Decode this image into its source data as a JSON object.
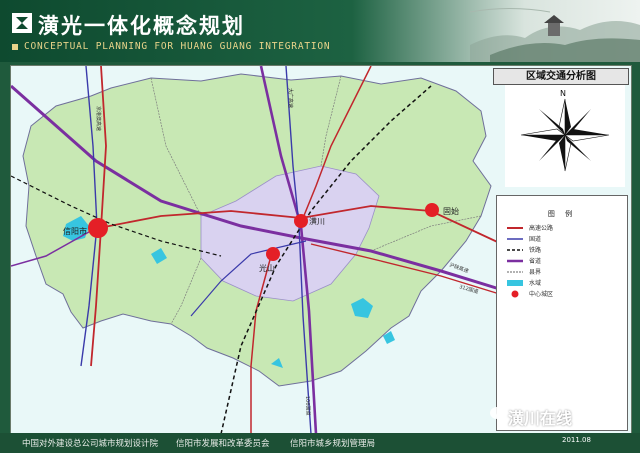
{
  "header": {
    "title": "潢光一体化概念规划",
    "subtitle": "CONCEPTUAL PLANNING FOR HUANG GUANG INTEGRATION"
  },
  "panel": {
    "title": "区域交通分析图",
    "north": "N"
  },
  "legend": {
    "title": "图 例",
    "items": [
      {
        "label": "高速公路",
        "icon": "highway-line",
        "color": "#c1272d"
      },
      {
        "label": "国道",
        "icon": "national-road-line",
        "color": "#3a3aaa"
      },
      {
        "label": "铁路",
        "icon": "railway-line",
        "color": "#111111"
      },
      {
        "label": "省道",
        "icon": "provincial-road-line",
        "color": "#7b2fa0"
      },
      {
        "label": "县界",
        "icon": "county-boundary-line",
        "color": "#666666"
      },
      {
        "label": "水域",
        "icon": "water-swatch",
        "color": "#37c5e0"
      },
      {
        "label": "中心城区",
        "icon": "center-city-dot",
        "color": "#e41f26"
      }
    ]
  },
  "cities": [
    {
      "name": "信阳市"
    },
    {
      "name": "潢川"
    },
    {
      "name": "光山"
    },
    {
      "name": "固始"
    }
  ],
  "road_labels": [
    "京港澳高速",
    "大广高速",
    "沪陕高速",
    "312国道",
    "106国道"
  ],
  "footer": {
    "org1": "中国对外建设总公司城市规划设计院",
    "org2": "信阳市发展和改革委员会",
    "org3": "信阳市城乡规划管理局",
    "date": "2011.08"
  },
  "watermark": "潢川在线",
  "colors": {
    "header_green": "#0e4a2f",
    "map_bg": "#e9f8f8",
    "region_fill": "#c8e8b4",
    "core_fill": "#d9d2f0",
    "accent_red": "#e41f26"
  }
}
